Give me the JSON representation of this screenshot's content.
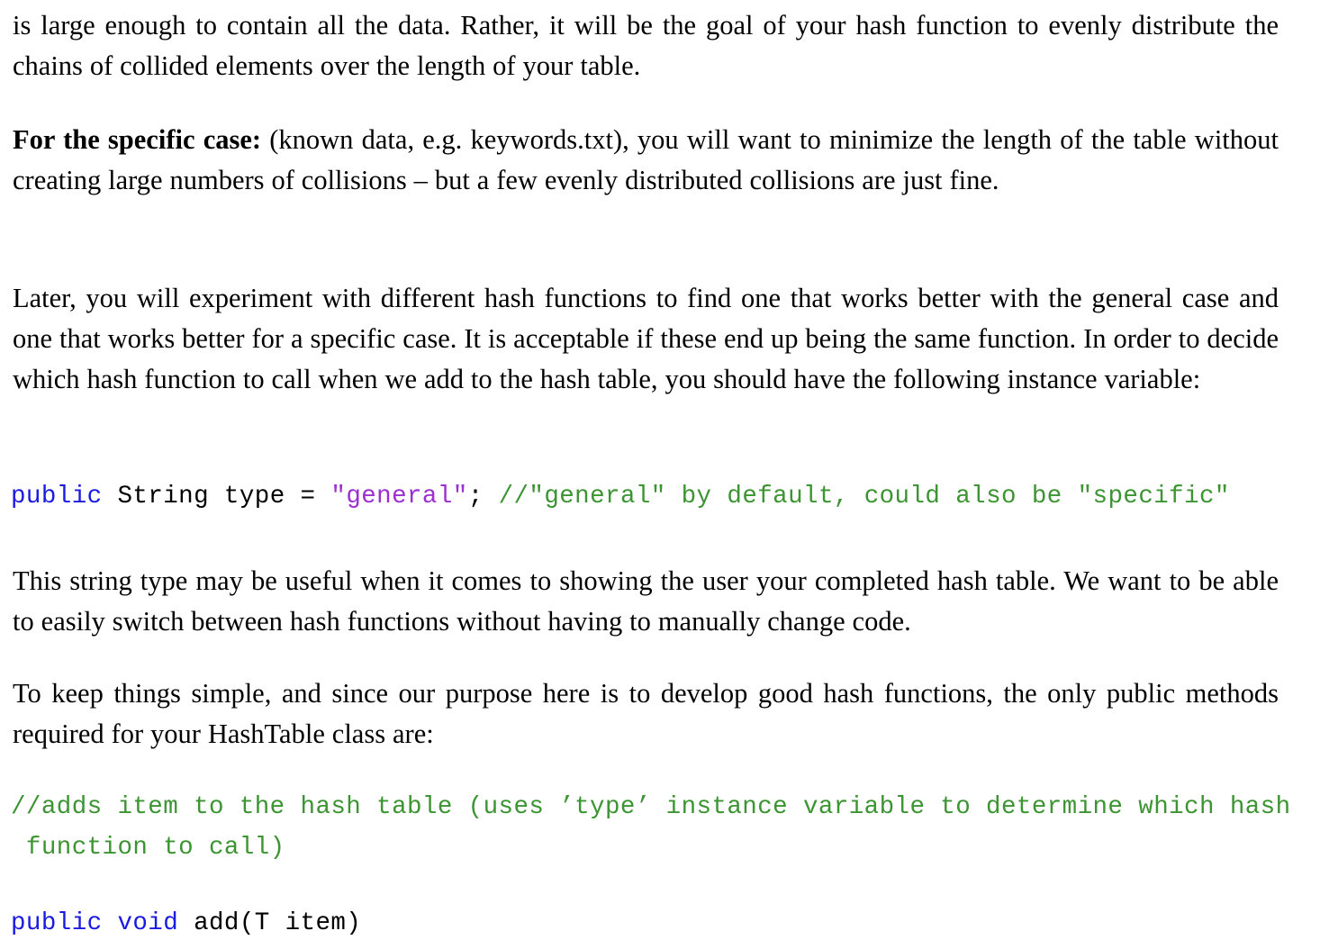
{
  "document": {
    "type": "latex-assignment-page",
    "background_color": "#ffffff",
    "text_color": "#000000",
    "syntax_colors": {
      "keyword": "#1a1ae0",
      "string": "#9b2fd0",
      "comment": "#3c9433",
      "plain": "#000000"
    }
  },
  "paragraphs": {
    "p1": "is large enough to contain all the data. Rather, it will be the goal of your hash function to evenly distribute the chains of collided elements over the length of your table.",
    "p2_lead": "For the specific case:",
    "p2_rest": " (known data, e.g. keywords.txt), you will want to minimize the length of the table without creating large numbers of collisions – but a few evenly distributed collisions are just fine.",
    "p3": "Later, you will experiment with different hash functions to find one that works better with the general case and one that works better for a specific case. It is acceptable if these end up being the same function. In order to decide which hash function to call when we add to the hash table, you should have the following instance variable:",
    "p4": "This string type may be useful when it comes to showing the user your completed hash table. We want to be able to easily switch between hash functions without having to manually change code.",
    "p5": "To keep things simple, and since our purpose here is to develop good hash functions, the only public methods required for your HashTable class are:"
  },
  "code_blocks": {
    "type_declaration": {
      "kw_public": "public",
      "decl": " String type = ",
      "string_general": "\"general\"",
      "semicolon": ";",
      "comment": " //\"general\" by default, could also be \"specific\""
    },
    "add_comment": {
      "line1": "//adds item to the hash table (uses ’type’ instance variable to determine which hash",
      "line2": " function to call)"
    },
    "add_signature": {
      "kw_public_void": "public void",
      "rest": " add(T item)"
    }
  }
}
